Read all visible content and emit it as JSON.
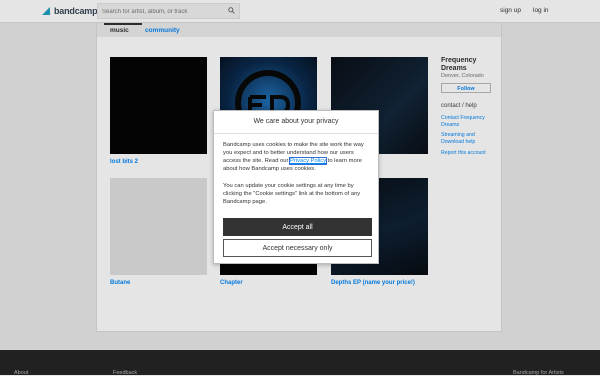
{
  "header": {
    "logo_text": "bandcamp",
    "search_placeholder": "Search for artist, album, or track",
    "signup": "sign up",
    "login": "log in"
  },
  "tabs": {
    "music": "music",
    "community": "community"
  },
  "albums": [
    {
      "title": "lost bits 2",
      "art_color": "#050505"
    },
    {
      "title": "",
      "art_color": "#0b2a4d"
    },
    {
      "title": "",
      "art_color": "#0a0f16"
    },
    {
      "title": "Butane",
      "art_color": "#e0e0e0"
    },
    {
      "title": "Chapter",
      "art_color": "#050505"
    },
    {
      "title": "Depths EP (name your price!)",
      "art_color": "#0a0f16"
    }
  ],
  "band": {
    "name": "Frequency Dreams",
    "location": "Denver, Colorado",
    "follow": "Follow",
    "contact_heading": "contact / help",
    "links": [
      "Contact Frequency Dreams",
      "Streaming and Download help",
      "Report this account"
    ]
  },
  "modal": {
    "title": "We care about your privacy",
    "p1_before": "Bandcamp uses cookies to make the site work the way you expect and to better understand how our users access the site. Read our ",
    "p1_link": "Privacy Policy",
    "p1_after": " to learn more about how Bandcamp uses cookies.",
    "p2": "You can update your cookie settings at any time by clicking the \"Cookie settings\" link at the bottom of any Bandcamp page.",
    "accept_all": "Accept all",
    "accept_necessary": "Accept necessary only"
  },
  "footer": {
    "links": [
      "About",
      "Feedback",
      "Bandcamp for Artists"
    ]
  },
  "colors": {
    "accent": "#0687f5",
    "dark_button": "#333333",
    "footer_bg": "#252525"
  }
}
